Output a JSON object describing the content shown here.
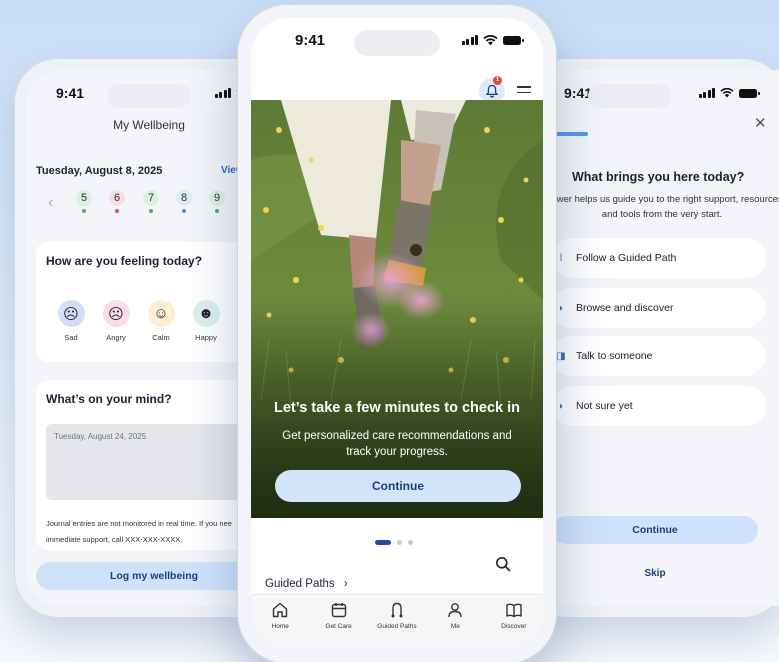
{
  "left": {
    "time": "9:41",
    "title": "My Wellbeing",
    "date": "Tuesday, August 8, 2025",
    "view": "View",
    "days": [
      {
        "num": "5",
        "color": "#d9f0e3",
        "dot": "#3cb46e"
      },
      {
        "num": "6",
        "color": "#f7dde3",
        "dot": "#e0516f"
      },
      {
        "num": "7",
        "color": "#d9f0e3",
        "dot": "#3cb46e"
      },
      {
        "num": "8",
        "color": "#dcecf7",
        "dot": "#3c9fd6"
      },
      {
        "num": "9",
        "color": "#d9f0e3",
        "dot": "#3cb46e"
      }
    ],
    "feeling_title": "How are you feeling today?",
    "emotions": [
      {
        "label": "Sad",
        "color": "#d5dcf7",
        "glyph": "☹"
      },
      {
        "label": "Angry",
        "color": "#f7dde6",
        "glyph": "☹"
      },
      {
        "label": "Calm",
        "color": "#fbeed3",
        "glyph": "☺"
      },
      {
        "label": "Happy",
        "color": "#dcefeb",
        "glyph": "☻"
      }
    ],
    "mind_title": "What’s on your mind?",
    "entry_placeholder": "Tuesday, August 24, 2025",
    "note_line1": "Journal entries are not monitored in real time. If you nee",
    "note_line2": "immediate support, call XXX-XXX-XXXX.",
    "log_label": "Log my wellbeing"
  },
  "center": {
    "time": "9:41",
    "badge": "1",
    "hero_title": "Let’s take a few minutes to check in",
    "hero_sub": "Get personalized care recommendations and track your progress.",
    "continue_label": "Continue",
    "guided_paths": "Guided Paths",
    "nav": [
      {
        "label": "Home",
        "icon": "home-icon"
      },
      {
        "label": "Get Care",
        "icon": "calendar-icon"
      },
      {
        "label": "Guided Paths",
        "icon": "path-icon"
      },
      {
        "label": "Me",
        "icon": "person-icon"
      },
      {
        "label": "Discover",
        "icon": "book-icon"
      }
    ]
  },
  "right": {
    "time": "9:41",
    "question": "What brings you here today?",
    "subtitle": "answer helps us guide you to the right support, resources and tools from the very start.",
    "options": [
      "Follow a Guided Path",
      "Browse and discover",
      "Talk to someone",
      "Not sure yet"
    ],
    "continue_label": "Continue",
    "skip_label": "Skip"
  },
  "colors": {
    "accent": "#1b3f7a",
    "button_bg": "#cfe2fb",
    "badge": "#e04a3d"
  }
}
